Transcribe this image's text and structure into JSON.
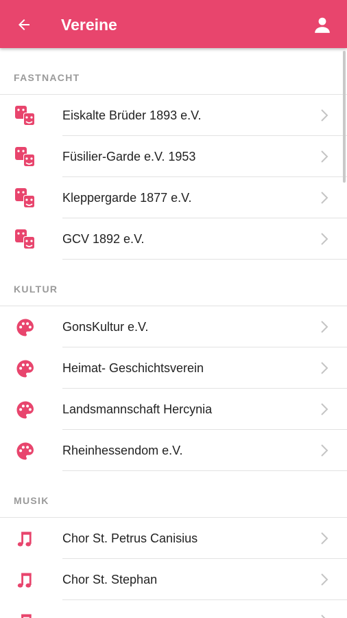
{
  "appbar": {
    "title": "Vereine",
    "back_icon": "arrow-left-icon",
    "profile_icon": "person-icon",
    "color": "#e8456d"
  },
  "accent_color": "#e8456d",
  "sections": [
    {
      "header": "FASTNACHT",
      "icon": "theater-masks-icon",
      "items": [
        {
          "label": "Eiskalte Brüder 1893 e.V."
        },
        {
          "label": "Füsilier-Garde e.V. 1953"
        },
        {
          "label": "Kleppergarde 1877 e.V."
        },
        {
          "label": "GCV 1892 e.V."
        }
      ]
    },
    {
      "header": "KULTUR",
      "icon": "palette-icon",
      "items": [
        {
          "label": "GonsKultur e.V."
        },
        {
          "label": "Heimat- Geschichtsverein"
        },
        {
          "label": "Landsmannschaft Hercynia"
        },
        {
          "label": "Rheinhessendom e.V."
        }
      ]
    },
    {
      "header": "MUSIK",
      "icon": "music-note-icon",
      "items": [
        {
          "label": "Chor St. Petrus Canisius"
        },
        {
          "label": "Chor St. Stephan"
        },
        {
          "label": ""
        }
      ]
    }
  ]
}
